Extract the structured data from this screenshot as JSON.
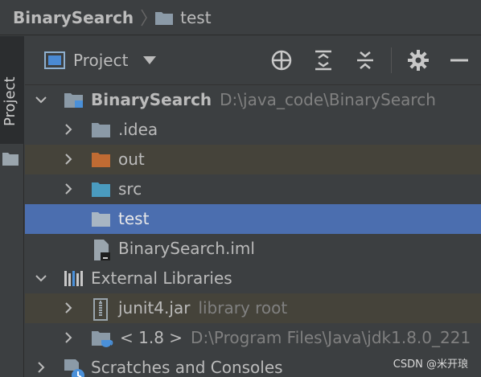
{
  "breadcrumb": {
    "root": "BinarySearch",
    "child": "test"
  },
  "tool_strip": {
    "tab_label": "Project"
  },
  "toolbar": {
    "view_label": "Project"
  },
  "tree": {
    "root": {
      "name": "BinarySearch",
      "path": "D:\\java_code\\BinarySearch"
    },
    "idea": ".idea",
    "out": "out",
    "src": "src",
    "test": "test",
    "iml": "BinarySearch.iml",
    "external": "External Libraries",
    "junit": {
      "name": "junit4.jar",
      "hint": "library root"
    },
    "jdk": {
      "name": "< 1.8 >",
      "path": "D:\\Program Files\\Java\\jdk1.8.0_221"
    },
    "scratches": "Scratches and Consoles"
  },
  "watermark": "CSDN @米开琅",
  "colors": {
    "background": "#3c3f41",
    "selection": "#4b6eaf",
    "excluded_row": "#45433a",
    "folder": "#8b9aa7",
    "out_folder": "#c06b33",
    "src_folder": "#4a9bbf"
  }
}
